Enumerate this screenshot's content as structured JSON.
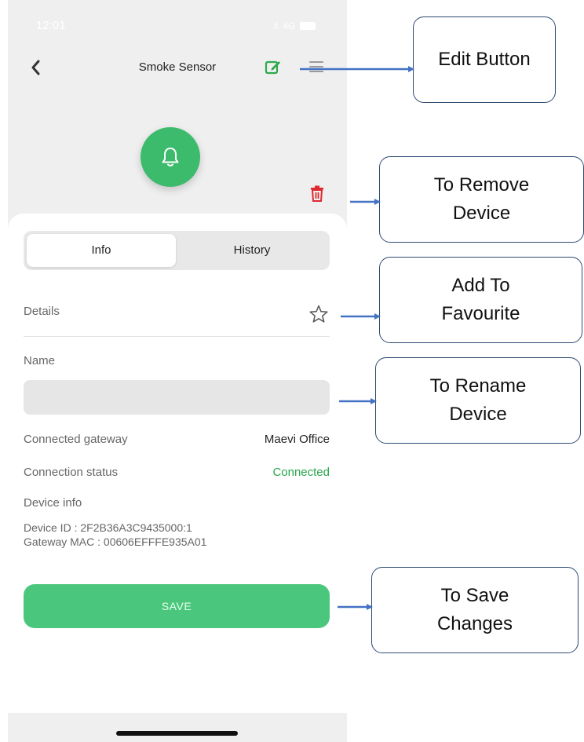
{
  "status_bar": {
    "time": "12:01",
    "signal": ".ıl",
    "network": "4G"
  },
  "header": {
    "title": "Smoke Sensor"
  },
  "icons": {
    "back": "chevron-left-icon",
    "edit": "edit-square-icon",
    "menu": "hamburger-menu-icon",
    "device": "bell-icon",
    "remove": "trash-icon",
    "favorite": "star-outline-icon"
  },
  "tabs": [
    {
      "label": "Info",
      "active": true
    },
    {
      "label": "History",
      "active": false
    }
  ],
  "details": {
    "label": "Details"
  },
  "name_field": {
    "label": "Name",
    "value": "",
    "placeholder": ""
  },
  "info_rows": [
    {
      "label": "Connected gateway",
      "value": "Maevi Office"
    },
    {
      "label": "Connection status",
      "value": "Connected"
    }
  ],
  "device_info": {
    "label": "Device info",
    "lines": [
      "Device ID : 2F2B36A3C9435000:1",
      "Gateway MAC : 00606EFFFE935A01"
    ]
  },
  "save_button": {
    "label": "SAVE"
  },
  "annotations": {
    "edit": "Edit Button",
    "remove": [
      "To Remove",
      "Device"
    ],
    "favourite": [
      "Add To",
      "Favourite"
    ],
    "rename": [
      "To Rename",
      "Device"
    ],
    "save": [
      "To Save",
      "Changes"
    ]
  },
  "colors": {
    "accent_green": "#3dbb6c",
    "save_green": "#4ac77d",
    "status_green": "#27a64b",
    "delete_red": "#e0282f",
    "annotation_border": "#2e4a73",
    "arrow_blue": "#4472c4"
  }
}
